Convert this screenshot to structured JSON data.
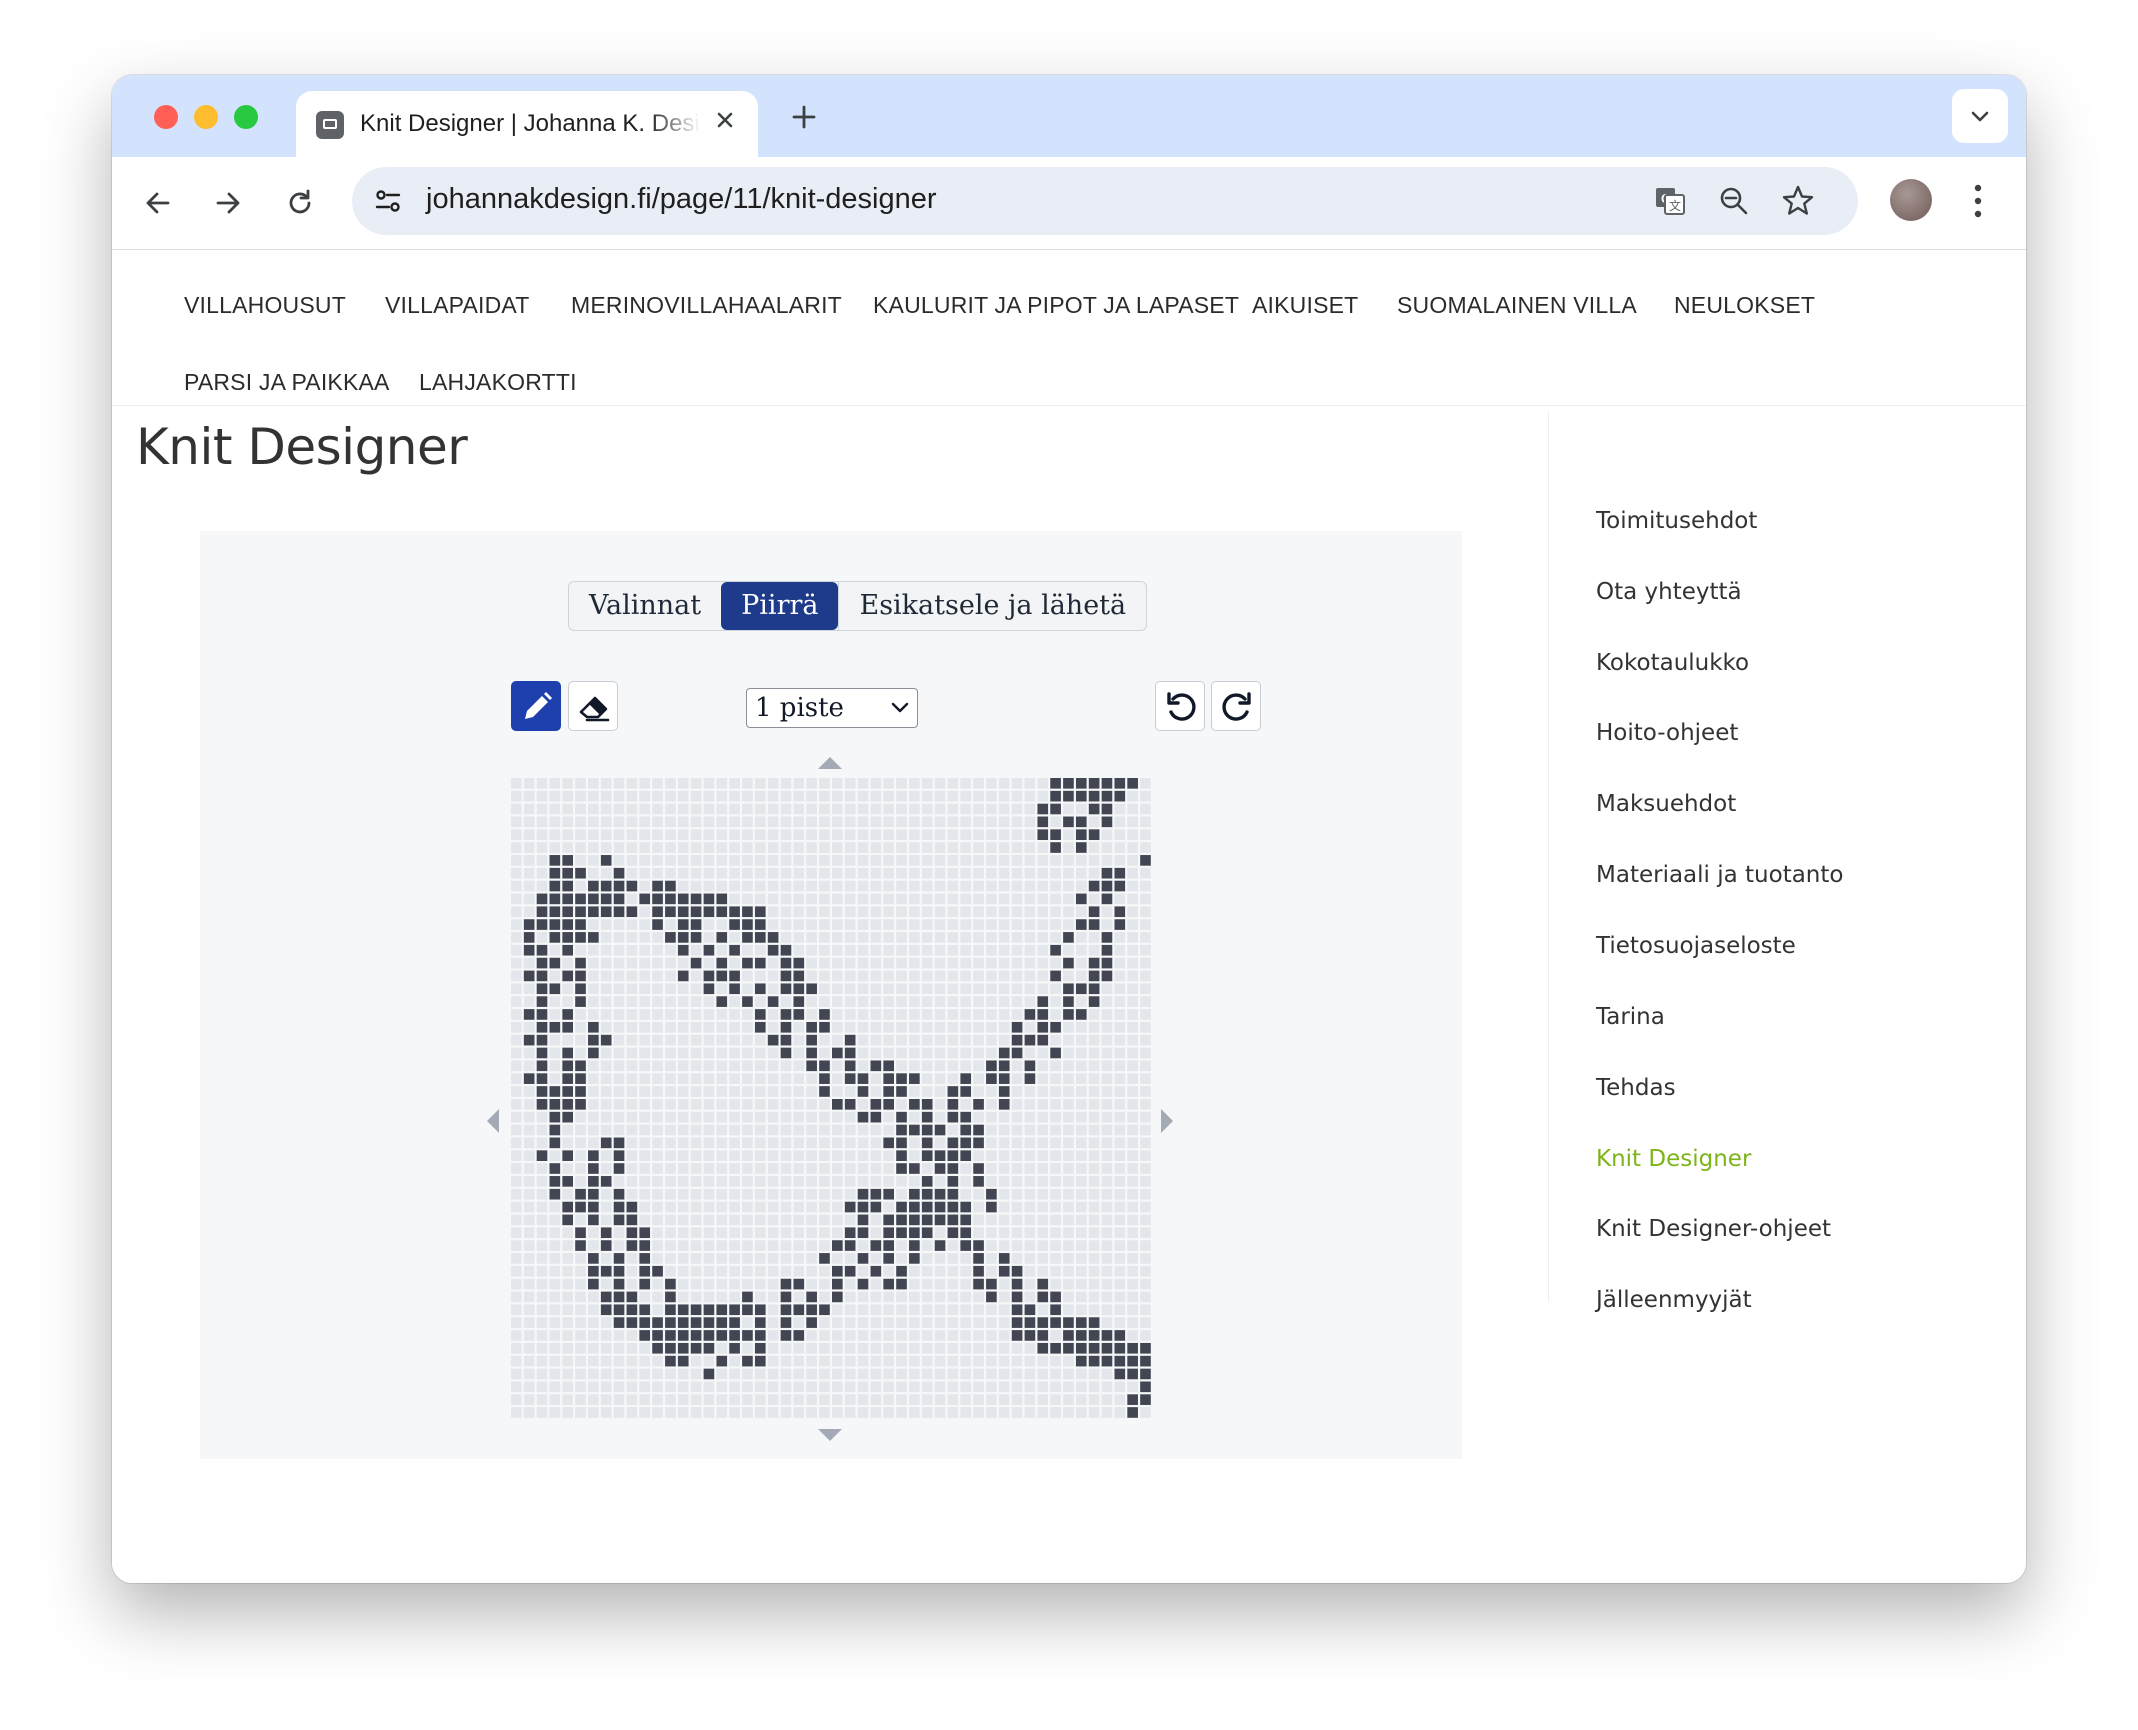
{
  "browser": {
    "tab_title": "Knit Designer | Johanna K. Design",
    "url": "johannakdesign.fi/page/11/knit-designer"
  },
  "nav": {
    "row1": [
      "VILLAHOUSUT",
      "VILLAPAIDAT",
      "MERINOVILLAHAALARIT",
      "KAULURIT JA PIPOT JA LAPASET",
      "AIKUISET",
      "SUOMALAINEN VILLA",
      "NEULOKSET"
    ],
    "row2": [
      "PARSI JA PAIKKAA",
      "LAHJAKORTTI"
    ]
  },
  "page": {
    "title": "Knit Designer"
  },
  "designer": {
    "tabs": [
      "Valinnat",
      "Piirrä",
      "Esikatsele ja lähetä"
    ],
    "active_tab": "Piirrä",
    "brush_size": "1 piste",
    "active_tool": "pencil",
    "grid": {
      "cols": 50,
      "rows": 50,
      "filled_color": "#414652",
      "empty_color": "#e3e6ea",
      "pattern": [
        "..........................................#######.",
        "..........................................######..",
        ".........................................##..##...",
        ".........................................#.##.#...",
        ".........................................##.##....",
        "..........................................#.#.....",
        "...##..#.........................................#",
        "...###..#.....................................##..",
        "...##.####.##................................###..",
        "..#######.#######...........................#.#...",
        "..########.#########.........................#.#..",
        ".#####.....#.##..###........................##.#..",
        ".#.####.....###.#.###......................#..#...",
        ".##.#........#.#.#..##....................#...#...",
        "..##.#........#.#.##.##....................#.##...",
        ".##.##.......#.###...##...................#..##...",
        "..##.#.........#.#.#.###...................###....",
        "..#..#..........#.#.#.#..................#.#.#....",
        ".##.#..............#.##.#...............##.##.....",
        "..###.#............#.#.##..............#.##.......",
        ".##...##............##.#..#............###........",
        "..#.#.#..............#.#.##...........##..#.......",
        "..#.##.................##.#.##.......##.#.........",
        ".##.##..................#.##.###...#.##.#.........",
        "..####..................#..#.##...##..#...........",
        "..####...................##.##.##.#.#.#...........",
        "...##......................##.#.#.##..............",
        "...#..........................####.##.............",
        "...#...##....................##.#.###.............",
        "..#.#.#.#.....................#.####..............",
        "...#..#.#.....................##.##.#.............",
        "...##.##........................#.#.#.............",
        "...#.##.#..................###.####..#............",
        "....###.##................###.######.#............",
        "....#.#.##.................#.#######..............",
        ".....#.#.##...............##.####.##..............",
        ".....#.#.##..............##.##.#.#.##.............",
        "......#.#.#.............#..#.#.#....#.#...........",
        "......###.##.............##.#.#.....#.##..........",
        "......#.#.#.#........##..#.#.##.....##.#.#........",
        ".......###..#.....#..#.#.#...........#.#.##.......",
        ".......####.########.####..............##.#.......",
        "........##########.#.#.#...............#######....",
        "..........##########.##................###.#####..",
        "...........#####.#.#.....................#########",
        "............##..#.##........................#######",
        "...............#...............................###",
        ".................................................#",
        "................................................##",
        "................................................#."
      ]
    }
  },
  "sidebar": {
    "items": [
      "Toimitusehdot",
      "Ota yhteyttä",
      "Kokotaulukko",
      "Hoito-ohjeet",
      "Maksuehdot",
      "Materiaali ja tuotanto",
      "Tietosuojaseloste",
      "Tarina",
      "Tehdas",
      "Knit Designer",
      "Knit Designer-ohjeet",
      "Jälleenmyyjät"
    ],
    "current": "Knit Designer"
  },
  "colors": {
    "accent": "#1e3a8a",
    "sidebar_current": "#7cb518",
    "tabstrip": "#d3e3fd"
  }
}
